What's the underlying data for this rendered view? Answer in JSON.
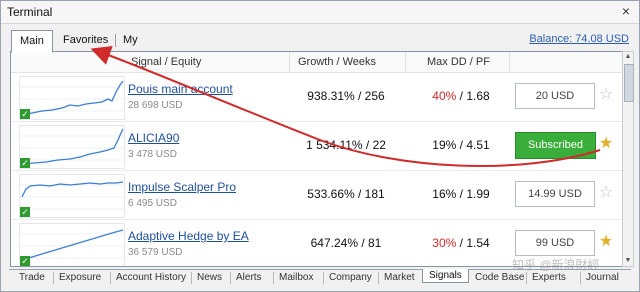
{
  "window": {
    "title": "Terminal",
    "close_glyph": "×"
  },
  "top_tabs": [
    {
      "label": "Main",
      "active": true
    },
    {
      "label": "Favorites",
      "active": false
    },
    {
      "label": "My Statistics",
      "active": false
    }
  ],
  "balance": "Balance: 74.08 USD",
  "table": {
    "headers": {
      "signal_equity": "Signal / Equity",
      "growth_weeks": "Growth / Weeks",
      "maxdd_pf": "Max DD / PF"
    },
    "rows": [
      {
        "name": "Pouis main account",
        "equity": "28 698 USD",
        "growth": "938.31% / 256",
        "maxdd": "40%",
        "maxdd_red": true,
        "pf": "1.68",
        "button": "20 USD",
        "subscribed": false,
        "favorite": false
      },
      {
        "name": "ALICIA90",
        "equity": "3 478 USD",
        "growth": "1 534.11% / 22",
        "maxdd": "19%",
        "maxdd_red": false,
        "pf": "4.51",
        "button": "Subscribed",
        "subscribed": true,
        "favorite": true
      },
      {
        "name": "Impulse Scalper Pro",
        "equity": "6 495 USD",
        "growth": "533.66% / 181",
        "maxdd": "16%",
        "maxdd_red": false,
        "pf": "1.99",
        "button": "14.99 USD",
        "subscribed": false,
        "favorite": false
      },
      {
        "name": "Adaptive Hedge by EA",
        "equity": "36 579 USD",
        "growth": "647.24% / 81",
        "maxdd": "30%",
        "maxdd_red": true,
        "pf": "1.54",
        "button": "99 USD",
        "subscribed": false,
        "favorite": true
      }
    ]
  },
  "bottom_tabs": [
    {
      "label": "Trade"
    },
    {
      "label": "Exposure"
    },
    {
      "label": "Account History"
    },
    {
      "label": "News"
    },
    {
      "label": "Alerts"
    },
    {
      "label": "Mailbox"
    },
    {
      "label": "Company"
    },
    {
      "label": "Market"
    },
    {
      "label": "Signals",
      "active": true
    },
    {
      "label": "Code Base"
    },
    {
      "label": "Experts"
    },
    {
      "label": "Journal"
    }
  ],
  "watermark": "知乎 @新浪財經",
  "colors": {
    "accent_link": "#1f4f9a",
    "subscribed_green": "#3aae3a",
    "drawdown_red": "#d12a2a",
    "favorite_star": "#e0b22a",
    "annotation_arrow": "#d12a2a"
  }
}
